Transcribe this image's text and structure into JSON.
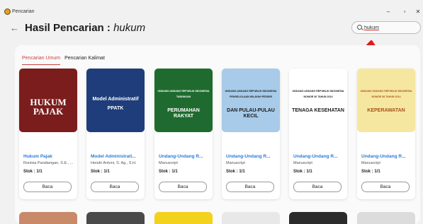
{
  "window": {
    "title": "Pencarian",
    "minimize": "–",
    "maximize": "▫",
    "close": "✕"
  },
  "header": {
    "back_icon": "←",
    "title_prefix": "Hasil Pencarian :",
    "title_query": "hukum"
  },
  "search": {
    "value": "hukum",
    "placeholder": ""
  },
  "tabs": [
    {
      "label": "Pencarian Umum",
      "active": true
    },
    {
      "label": "Pencarian Kalimat",
      "active": false
    }
  ],
  "cards": [
    {
      "title": "Hukum Pajak",
      "subtitle": "Ronisia Pandiangan, S.E., ...",
      "stock": "Stok : 1/1",
      "button": "Baca",
      "cover_lines": [
        "HUKUM",
        "PAJAK"
      ],
      "cover_color": "#7a1d1c"
    },
    {
      "title": "Model Administrati...",
      "subtitle": "Hendri Antoni, S. Ag., S.H.",
      "stock": "Stok : 1/1",
      "button": "Baca",
      "cover_lines": [
        "Model Administratif",
        "PPATK"
      ],
      "cover_color": "#1f3d7a"
    },
    {
      "title": "Undang-Undang R...",
      "subtitle": "Manuscript",
      "stock": "Stok : 1/1",
      "button": "Baca",
      "cover_lines": [
        "UNDANG-UNDANG REPUBLIK INDONESIA",
        "TABUNGAN",
        "PERUMAHAN RAKYAT"
      ],
      "cover_color": "#1f6b2f"
    },
    {
      "title": "Undang-Undang R...",
      "subtitle": "Manuscript",
      "stock": "Stok : 1/1",
      "button": "Baca",
      "cover_lines": [
        "UNDANG-UNDANG REPUBLIK INDONESIA",
        "PENGELOLAAN WILAYAH PESISIR",
        "DAN PULAU-PULAU KECIL"
      ],
      "cover_color": "#a7cbe8"
    },
    {
      "title": "Undang-Undang R...",
      "subtitle": "Manuscript",
      "stock": "Stok : 1/1",
      "button": "Baca",
      "cover_lines": [
        "UNDANG-UNDANG REPUBLIK INDONESIA",
        "NOMOR 36 TAHUN 2014",
        "TENAGA KESEHATAN"
      ],
      "cover_color": "#ffffff"
    },
    {
      "title": "Undang-Undang R...",
      "subtitle": "Manuscript",
      "stock": "Stok : 1/1",
      "button": "Baca",
      "cover_lines": [
        "UNDANG-UNDANG REPUBLIK INDONESIA",
        "NOMOR 38 TAHUN 2014",
        "KEPERAWATAN"
      ],
      "cover_color": "#f6e7a0"
    }
  ],
  "row2_colors": [
    "#c98a6a",
    "#4a4a4a",
    "#f2d21c",
    "#e8e8e8",
    "#2b2b2b",
    "#dcdcdc"
  ],
  "accent": "#c9413e",
  "link_color": "#2a7bd5"
}
